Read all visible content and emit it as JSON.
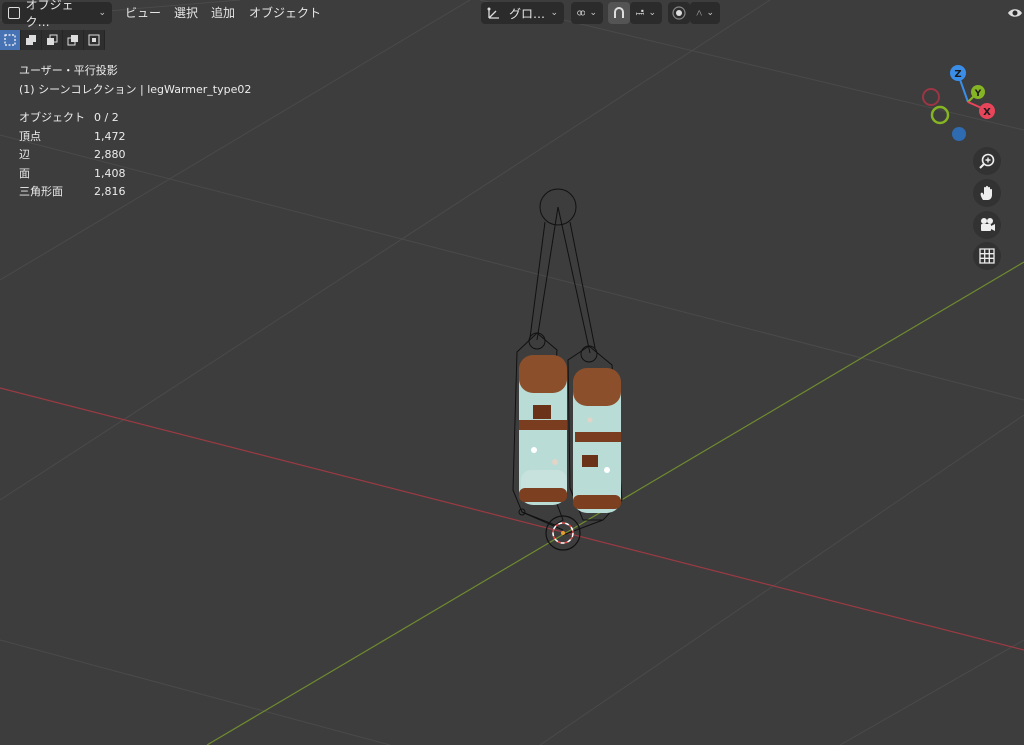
{
  "header": {
    "mode_label": "オブジェク…",
    "menus": [
      "ビュー",
      "選択",
      "追加",
      "オブジェクト"
    ],
    "transform_orientation": "グロ…",
    "icons": {
      "editor_type": "viewport-icon",
      "orientation": "transform-orientation-icon",
      "snap_link": "link-icon",
      "snap_magnet": "magnet-icon",
      "snap_increment": "snap-increment-icon",
      "proportional": "proportional-edit-icon",
      "falloff": "falloff-curve-icon",
      "visibility": "eye-icon"
    }
  },
  "select_modes": [
    "select-new-icon",
    "select-extend-icon",
    "select-subtract-icon",
    "select-invert-icon",
    "select-intersect-icon"
  ],
  "overlay": {
    "view_name": "ユーザー・平行投影",
    "collection": "(1) シーンコレクション | legWarmer_type02",
    "stats": [
      {
        "label": "オブジェクト",
        "value": "0 / 2"
      },
      {
        "label": "頂点",
        "value": "1,472"
      },
      {
        "label": "辺",
        "value": "2,880"
      },
      {
        "label": "面",
        "value": "1,408"
      },
      {
        "label": "三角形面",
        "value": "2,816"
      }
    ]
  },
  "gizmo": {
    "x_label": "X",
    "y_label": "Y",
    "z_label": "Z",
    "colors": {
      "x": "#e8455b",
      "y": "#86b524",
      "z": "#3b8ee8",
      "neg_x": "#9c3544",
      "neg_y": "#5e7f1d",
      "neg_z": "#2f6bb0"
    }
  },
  "nav_buttons": [
    "zoom-icon",
    "pan-hand-icon",
    "camera-icon",
    "grid-perspective-icon"
  ],
  "colors": {
    "viewport_bg": "#3d3d3d",
    "x_axis": "#9e3a43",
    "y_axis": "#6e8a2e",
    "grid": "#4b4b4b",
    "accent": "#4772b3"
  }
}
